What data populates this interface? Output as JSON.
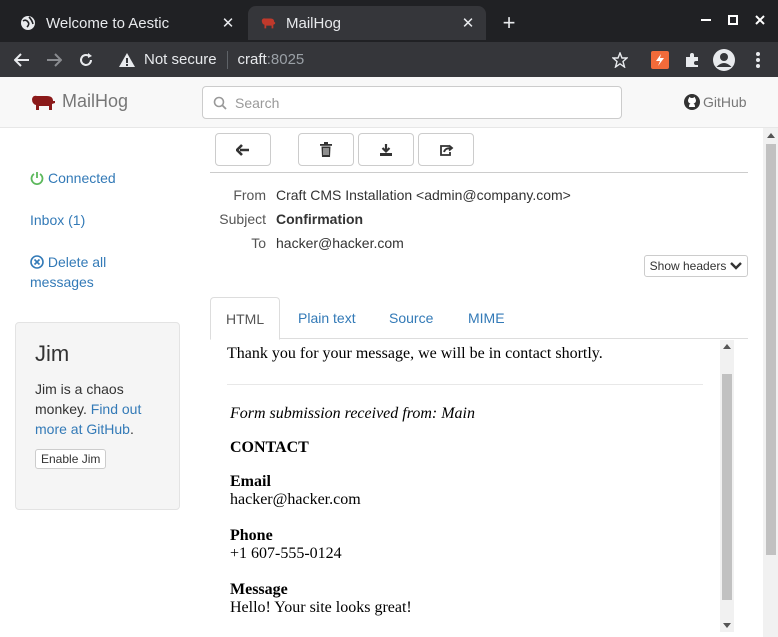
{
  "browser": {
    "tabs": [
      {
        "title": "Welcome to Aestic",
        "active": false
      },
      {
        "title": "MailHog",
        "active": true
      }
    ],
    "address": {
      "security": "Not secure",
      "host": "craft",
      "port": ":8025"
    }
  },
  "header": {
    "brand": "MailHog",
    "search_placeholder": "Search",
    "github_label": "GitHub"
  },
  "sidebar": {
    "connected": "Connected",
    "inbox": "Inbox (1)",
    "delete_all": "Delete all messages"
  },
  "jim": {
    "title": "Jim",
    "text": "Jim is a chaos monkey.",
    "link": "Find out more at GitHub",
    "link_suffix": ".",
    "button": "Enable Jim"
  },
  "message": {
    "from_label": "From",
    "from": "Craft CMS Installation <admin@company.com>",
    "subject_label": "Subject",
    "subject": "Confirmation",
    "to_label": "To",
    "to": "hacker@hacker.com",
    "show_headers": "Show headers",
    "tabs": [
      "HTML",
      "Plain text",
      "Source",
      "MIME"
    ],
    "body": {
      "intro": "Thank you for your message, we will be in contact shortly.",
      "submission": "Form submission received from: Main",
      "contact_heading": "CONTACT",
      "email_label": "Email",
      "email": "hacker@hacker.com",
      "phone_label": "Phone",
      "phone": "+1 607-555-0124",
      "message_label": "Message",
      "message": "Hello! Your site looks great!"
    }
  },
  "colors": {
    "link": "#337ab7",
    "connected": "#5cb85c",
    "brand": "#8b1a1a"
  }
}
